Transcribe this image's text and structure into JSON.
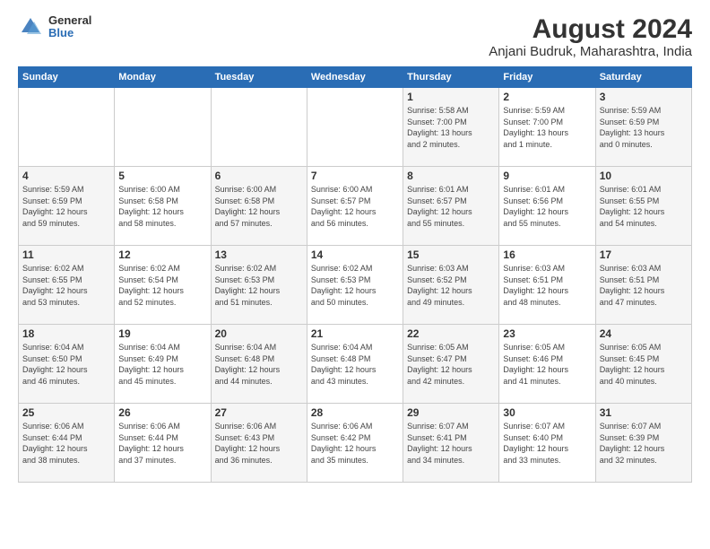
{
  "logo": {
    "general": "General",
    "blue": "Blue"
  },
  "title": "August 2024",
  "subtitle": "Anjani Budruk, Maharashtra, India",
  "weekdays": [
    "Sunday",
    "Monday",
    "Tuesday",
    "Wednesday",
    "Thursday",
    "Friday",
    "Saturday"
  ],
  "weeks": [
    [
      {
        "day": "",
        "info": ""
      },
      {
        "day": "",
        "info": ""
      },
      {
        "day": "",
        "info": ""
      },
      {
        "day": "",
        "info": ""
      },
      {
        "day": "1",
        "info": "Sunrise: 5:58 AM\nSunset: 7:00 PM\nDaylight: 13 hours\nand 2 minutes."
      },
      {
        "day": "2",
        "info": "Sunrise: 5:59 AM\nSunset: 7:00 PM\nDaylight: 13 hours\nand 1 minute."
      },
      {
        "day": "3",
        "info": "Sunrise: 5:59 AM\nSunset: 6:59 PM\nDaylight: 13 hours\nand 0 minutes."
      }
    ],
    [
      {
        "day": "4",
        "info": "Sunrise: 5:59 AM\nSunset: 6:59 PM\nDaylight: 12 hours\nand 59 minutes."
      },
      {
        "day": "5",
        "info": "Sunrise: 6:00 AM\nSunset: 6:58 PM\nDaylight: 12 hours\nand 58 minutes."
      },
      {
        "day": "6",
        "info": "Sunrise: 6:00 AM\nSunset: 6:58 PM\nDaylight: 12 hours\nand 57 minutes."
      },
      {
        "day": "7",
        "info": "Sunrise: 6:00 AM\nSunset: 6:57 PM\nDaylight: 12 hours\nand 56 minutes."
      },
      {
        "day": "8",
        "info": "Sunrise: 6:01 AM\nSunset: 6:57 PM\nDaylight: 12 hours\nand 55 minutes."
      },
      {
        "day": "9",
        "info": "Sunrise: 6:01 AM\nSunset: 6:56 PM\nDaylight: 12 hours\nand 55 minutes."
      },
      {
        "day": "10",
        "info": "Sunrise: 6:01 AM\nSunset: 6:55 PM\nDaylight: 12 hours\nand 54 minutes."
      }
    ],
    [
      {
        "day": "11",
        "info": "Sunrise: 6:02 AM\nSunset: 6:55 PM\nDaylight: 12 hours\nand 53 minutes."
      },
      {
        "day": "12",
        "info": "Sunrise: 6:02 AM\nSunset: 6:54 PM\nDaylight: 12 hours\nand 52 minutes."
      },
      {
        "day": "13",
        "info": "Sunrise: 6:02 AM\nSunset: 6:53 PM\nDaylight: 12 hours\nand 51 minutes."
      },
      {
        "day": "14",
        "info": "Sunrise: 6:02 AM\nSunset: 6:53 PM\nDaylight: 12 hours\nand 50 minutes."
      },
      {
        "day": "15",
        "info": "Sunrise: 6:03 AM\nSunset: 6:52 PM\nDaylight: 12 hours\nand 49 minutes."
      },
      {
        "day": "16",
        "info": "Sunrise: 6:03 AM\nSunset: 6:51 PM\nDaylight: 12 hours\nand 48 minutes."
      },
      {
        "day": "17",
        "info": "Sunrise: 6:03 AM\nSunset: 6:51 PM\nDaylight: 12 hours\nand 47 minutes."
      }
    ],
    [
      {
        "day": "18",
        "info": "Sunrise: 6:04 AM\nSunset: 6:50 PM\nDaylight: 12 hours\nand 46 minutes."
      },
      {
        "day": "19",
        "info": "Sunrise: 6:04 AM\nSunset: 6:49 PM\nDaylight: 12 hours\nand 45 minutes."
      },
      {
        "day": "20",
        "info": "Sunrise: 6:04 AM\nSunset: 6:48 PM\nDaylight: 12 hours\nand 44 minutes."
      },
      {
        "day": "21",
        "info": "Sunrise: 6:04 AM\nSunset: 6:48 PM\nDaylight: 12 hours\nand 43 minutes."
      },
      {
        "day": "22",
        "info": "Sunrise: 6:05 AM\nSunset: 6:47 PM\nDaylight: 12 hours\nand 42 minutes."
      },
      {
        "day": "23",
        "info": "Sunrise: 6:05 AM\nSunset: 6:46 PM\nDaylight: 12 hours\nand 41 minutes."
      },
      {
        "day": "24",
        "info": "Sunrise: 6:05 AM\nSunset: 6:45 PM\nDaylight: 12 hours\nand 40 minutes."
      }
    ],
    [
      {
        "day": "25",
        "info": "Sunrise: 6:06 AM\nSunset: 6:44 PM\nDaylight: 12 hours\nand 38 minutes."
      },
      {
        "day": "26",
        "info": "Sunrise: 6:06 AM\nSunset: 6:44 PM\nDaylight: 12 hours\nand 37 minutes."
      },
      {
        "day": "27",
        "info": "Sunrise: 6:06 AM\nSunset: 6:43 PM\nDaylight: 12 hours\nand 36 minutes."
      },
      {
        "day": "28",
        "info": "Sunrise: 6:06 AM\nSunset: 6:42 PM\nDaylight: 12 hours\nand 35 minutes."
      },
      {
        "day": "29",
        "info": "Sunrise: 6:07 AM\nSunset: 6:41 PM\nDaylight: 12 hours\nand 34 minutes."
      },
      {
        "day": "30",
        "info": "Sunrise: 6:07 AM\nSunset: 6:40 PM\nDaylight: 12 hours\nand 33 minutes."
      },
      {
        "day": "31",
        "info": "Sunrise: 6:07 AM\nSunset: 6:39 PM\nDaylight: 12 hours\nand 32 minutes."
      }
    ]
  ]
}
